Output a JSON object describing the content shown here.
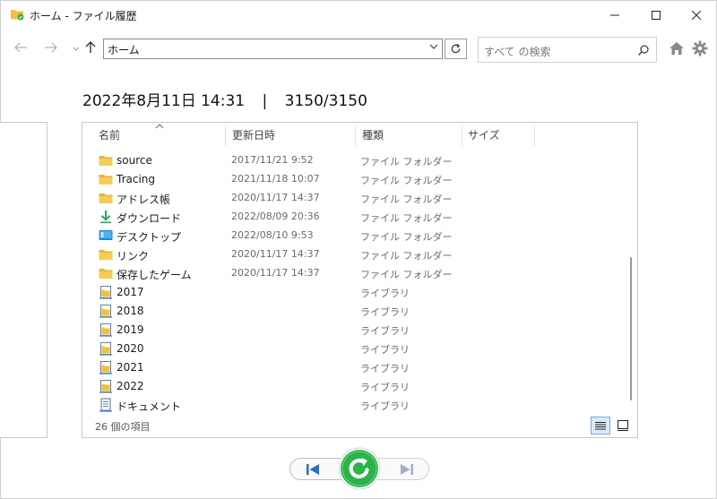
{
  "window": {
    "title": "ホーム - ファイル履歴"
  },
  "nav": {
    "address": "ホーム",
    "search_placeholder": "すべて の検索"
  },
  "snapshot": {
    "date_time": "2022年8月11日 14:31",
    "separator": "|",
    "position": "3150/3150"
  },
  "columns": {
    "name": "名前",
    "modified": "更新日時",
    "type": "種類",
    "size": "サイズ"
  },
  "files": [
    {
      "name": "source",
      "modified": "2017/11/21 9:52",
      "type": "ファイル フォルダー",
      "icon": "folder-icon"
    },
    {
      "name": "Tracing",
      "modified": "2021/11/18 10:07",
      "type": "ファイル フォルダー",
      "icon": "folder-icon"
    },
    {
      "name": "アドレス帳",
      "modified": "2020/11/17 14:37",
      "type": "ファイル フォルダー",
      "icon": "folder-icon"
    },
    {
      "name": "ダウンロード",
      "modified": "2022/08/09 20:36",
      "type": "ファイル フォルダー",
      "icon": "download-icon"
    },
    {
      "name": "デスクトップ",
      "modified": "2022/08/10 9:53",
      "type": "ファイル フォルダー",
      "icon": "desktop-icon"
    },
    {
      "name": "リンク",
      "modified": "2020/11/17 14:37",
      "type": "ファイル フォルダー",
      "icon": "folder-icon"
    },
    {
      "name": "保存したゲーム",
      "modified": "2020/11/17 14:37",
      "type": "ファイル フォルダー",
      "icon": "folder-icon"
    },
    {
      "name": "2017",
      "modified": "",
      "type": "ライブラリ",
      "icon": "library-icon"
    },
    {
      "name": "2018",
      "modified": "",
      "type": "ライブラリ",
      "icon": "library-icon"
    },
    {
      "name": "2019",
      "modified": "",
      "type": "ライブラリ",
      "icon": "library-icon"
    },
    {
      "name": "2020",
      "modified": "",
      "type": "ライブラリ",
      "icon": "library-icon"
    },
    {
      "name": "2021",
      "modified": "",
      "type": "ライブラリ",
      "icon": "library-icon"
    },
    {
      "name": "2022",
      "modified": "",
      "type": "ライブラリ",
      "icon": "library-icon"
    },
    {
      "name": "ドキュメント",
      "modified": "",
      "type": "ライブラリ",
      "icon": "documents-library-icon"
    }
  ],
  "status": {
    "item_count": "26 個の項目"
  },
  "colors": {
    "folder": "#f5c542",
    "download": "#2aa65a",
    "restore_green": "#2cb34a",
    "accent_blue": "#2b6fb6"
  }
}
